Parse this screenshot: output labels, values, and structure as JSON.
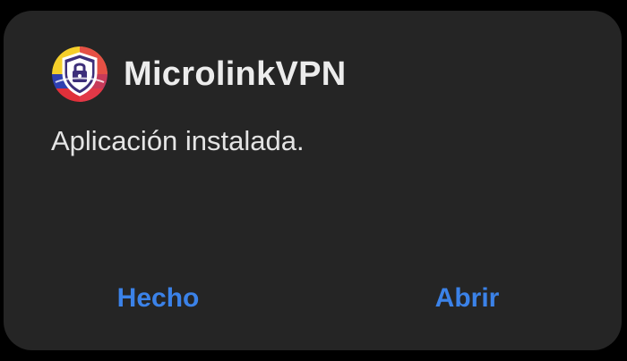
{
  "dialog": {
    "app_name": "MicrolinkVPN",
    "app_icon": "shield-lock-icon",
    "message": "Aplicación instalada.",
    "buttons": {
      "done_label": "Hecho",
      "open_label": "Abrir"
    },
    "colors": {
      "background": "#252525",
      "accent": "#3b82e8",
      "text": "#e4e4e4"
    }
  }
}
